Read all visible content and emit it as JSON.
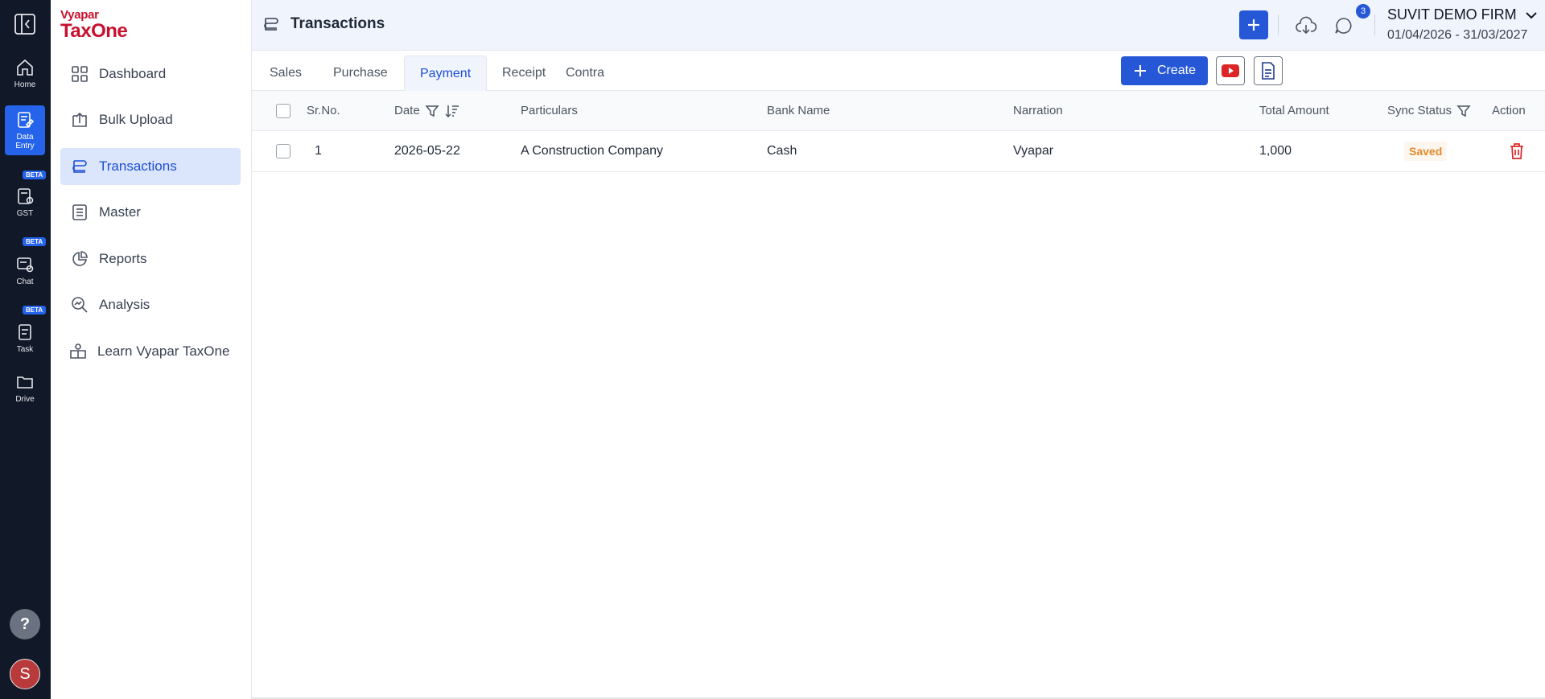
{
  "rail": {
    "items": [
      {
        "label": "Home"
      },
      {
        "label": "Data Entry"
      },
      {
        "label": "GST",
        "badge": "BETA"
      },
      {
        "label": "Chat",
        "badge": "BETA"
      },
      {
        "label": "Task",
        "badge": "BETA"
      },
      {
        "label": "Drive"
      }
    ],
    "help_label": "?",
    "avatar_initial": "S"
  },
  "logo": {
    "top": "Vyapar",
    "bottom": "TaxOne"
  },
  "sidebar": {
    "items": [
      {
        "label": "Dashboard"
      },
      {
        "label": "Bulk Upload"
      },
      {
        "label": "Transactions",
        "active": true
      },
      {
        "label": "Master"
      },
      {
        "label": "Reports"
      },
      {
        "label": "Analysis"
      },
      {
        "label": "Learn Vyapar TaxOne"
      }
    ]
  },
  "header": {
    "title": "Transactions",
    "notification_count": "3",
    "firm_name": "SUVIT DEMO FIRM",
    "date_range": "01/04/2026 - 31/03/2027"
  },
  "tabs": [
    {
      "label": "Sales"
    },
    {
      "label": "Purchase"
    },
    {
      "label": "Payment",
      "active": true
    },
    {
      "label": "Receipt"
    },
    {
      "label": "Contra"
    }
  ],
  "actions": {
    "create_label": "Create"
  },
  "table": {
    "columns": [
      "Sr.No.",
      "Date",
      "Particulars",
      "Bank Name",
      "Narration",
      "Total Amount",
      "Sync Status",
      "Action"
    ],
    "rows": [
      {
        "sr": "1",
        "date": "2026-05-22",
        "particulars": "A Construction Company",
        "bank": "Cash",
        "narration": "Vyapar",
        "amount": "1,000",
        "status": "Saved"
      }
    ]
  },
  "colors": {
    "accent": "#2557d6",
    "brand": "#c8102e",
    "rail_bg": "#111827",
    "saved": "#e08a2c",
    "delete": "#dc2626"
  }
}
